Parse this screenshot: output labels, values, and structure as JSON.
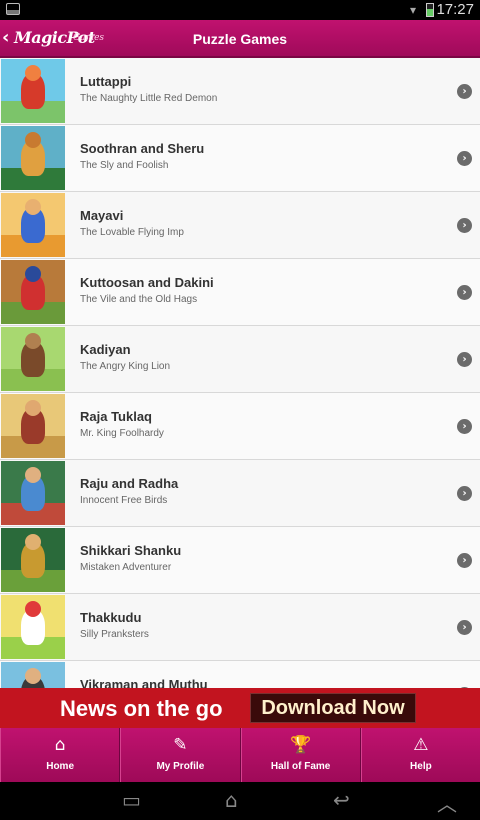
{
  "status_bar": {
    "time": "17:27"
  },
  "header": {
    "logo": "MagicPot",
    "logo_sub": "Games",
    "title": "Puzzle Games"
  },
  "games": [
    {
      "name": "Luttappi",
      "subtitle": "The Naughty Little Red Demon",
      "sky": "#6fc9e8",
      "ground": "#7cc46a",
      "figure": "#d63a2a",
      "head": "#f08040"
    },
    {
      "name": "Soothran and Sheru",
      "subtitle": "The Sly and Foolish",
      "sky": "#5fb0c8",
      "ground": "#2f7a3a",
      "figure": "#e0a040",
      "head": "#c87a30"
    },
    {
      "name": "Mayavi",
      "subtitle": "The Lovable Flying Imp",
      "sky": "#f4c870",
      "ground": "#e89a30",
      "figure": "#3a6ad0",
      "head": "#e8b070"
    },
    {
      "name": "Kuttoosan and Dakini",
      "subtitle": "The Vile and the Old Hags",
      "sky": "#b87a3a",
      "ground": "#6a9a3a",
      "figure": "#d03030",
      "head": "#2a4a9a"
    },
    {
      "name": "Kadiyan",
      "subtitle": "The Angry King Lion",
      "sky": "#a8d870",
      "ground": "#8ac050",
      "figure": "#7a4a2a",
      "head": "#b08050"
    },
    {
      "name": "Raja Tuklaq",
      "subtitle": "Mr. King Foolhardy",
      "sky": "#e8c878",
      "ground": "#c89a48",
      "figure": "#9a3a2a",
      "head": "#e0a870"
    },
    {
      "name": "Raju and Radha",
      "subtitle": "Innocent Free Birds",
      "sky": "#3a7a4a",
      "ground": "#c04a3a",
      "figure": "#4a8ad0",
      "head": "#e0b080"
    },
    {
      "name": "Shikkari Shanku",
      "subtitle": "Mistaken Adventurer",
      "sky": "#2a6a3a",
      "ground": "#6aa03a",
      "figure": "#c89a30",
      "head": "#e0b070"
    },
    {
      "name": "Thakkudu",
      "subtitle": "Silly Pranksters",
      "sky": "#f0e070",
      "ground": "#9ad04a",
      "figure": "#ffffff",
      "head": "#e03a3a"
    },
    {
      "name": "Vikraman and Muthu",
      "subtitle": "",
      "sky": "#7ac0e0",
      "ground": "#5a9a4a",
      "figure": "#3a3a3a",
      "head": "#e0b080"
    }
  ],
  "ad": {
    "headline": "News on the go",
    "cta": "Download Now"
  },
  "tabs": [
    {
      "label": "Home",
      "icon": "home-icon",
      "glyph": "⌂"
    },
    {
      "label": "My Profile",
      "icon": "profile-icon",
      "glyph": "✎"
    },
    {
      "label": "Hall of Fame",
      "icon": "trophy-icon",
      "glyph": "🏆"
    },
    {
      "label": "Help",
      "icon": "warning-icon",
      "glyph": "⚠"
    }
  ],
  "nav": {
    "recents_icon": "recents-icon",
    "home_icon": "android-home-icon",
    "back_icon": "back-arrow-icon",
    "up_icon": "up-chevron-icon"
  }
}
